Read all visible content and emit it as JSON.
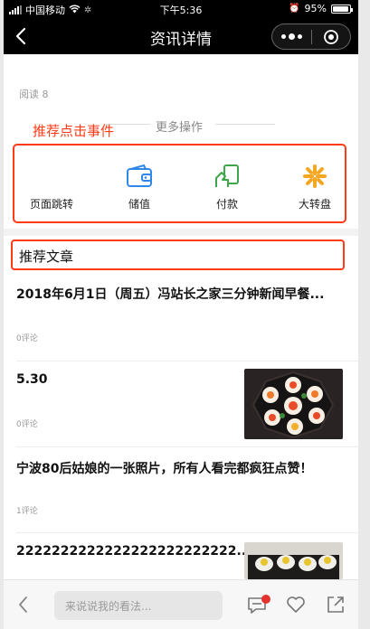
{
  "status_bar": {
    "carrier": "中国移动",
    "time": "下午5:36",
    "battery": "95%",
    "battery_level": 0.95
  },
  "nav": {
    "title": "资讯详情"
  },
  "article_meta": {
    "read_count": "阅读 8"
  },
  "more_ops": {
    "label": "更多操作"
  },
  "annotations": {
    "recommend_click_events": "推荐点击事件"
  },
  "actions": [
    {
      "label": "页面跳转",
      "icon": "page-jump"
    },
    {
      "label": "储值",
      "icon": "wallet-icon"
    },
    {
      "label": "付款",
      "icon": "payment-icon"
    },
    {
      "label": "大转盘",
      "icon": "wheel-icon"
    }
  ],
  "recommended": {
    "heading": "推荐文章",
    "items": [
      {
        "title": "2018年6月1日（周五）冯站长之家三分钟新闻早餐...",
        "comments": "0评论"
      },
      {
        "title": "5.30",
        "comments": "0评论"
      },
      {
        "title": "宁波80后姑娘的一张照片，所有人看完都疯狂点赞！",
        "comments": "1评论"
      },
      {
        "title": "2222222222222222222222222...",
        "comments": ""
      }
    ]
  },
  "bottom_bar": {
    "comment_placeholder": "来说说我的看法..."
  },
  "colors": {
    "annotation": "#ff3b17",
    "icon_blue": "#2f88e8",
    "icon_green": "#3da64a",
    "icon_orange": "#f5a623"
  }
}
